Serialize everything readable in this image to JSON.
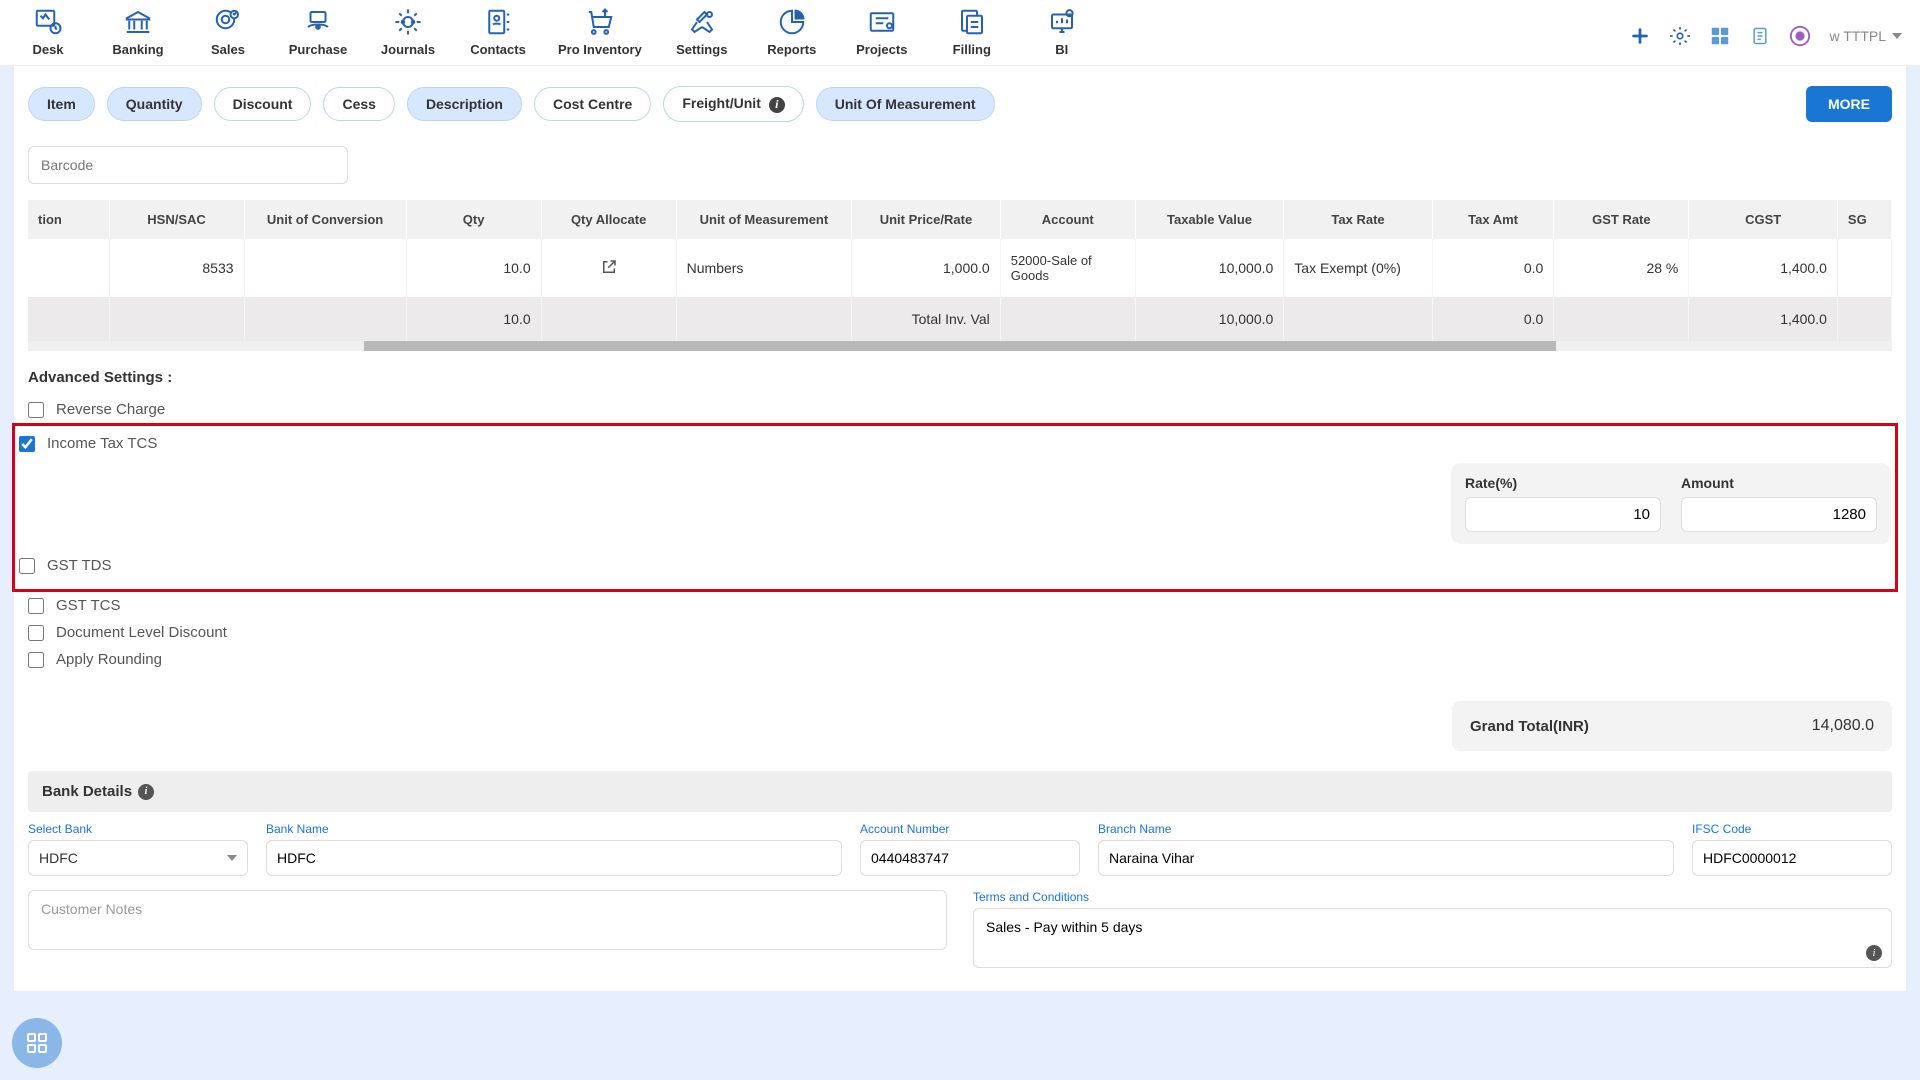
{
  "nav": [
    "Desk",
    "Banking",
    "Sales",
    "Purchase",
    "Journals",
    "Contacts",
    "Pro Inventory",
    "Settings",
    "Reports",
    "Projects",
    "Filling",
    "BI"
  ],
  "account_label": "w TTTPL",
  "chips": [
    {
      "label": "Item",
      "active": true
    },
    {
      "label": "Quantity",
      "active": true
    },
    {
      "label": "Discount",
      "active": false
    },
    {
      "label": "Cess",
      "active": false
    },
    {
      "label": "Description",
      "active": true
    },
    {
      "label": "Cost Centre",
      "active": false
    },
    {
      "label": "Freight/Unit",
      "active": false,
      "info": true
    },
    {
      "label": "Unit Of Measurement",
      "active": true
    }
  ],
  "more_label": "MORE",
  "barcode_placeholder": "Barcode",
  "columns": [
    "tion",
    "HSN/SAC",
    "Unit of Conversion",
    "Qty",
    "Qty Allocate",
    "Unit of Measurement",
    "Unit Price/Rate",
    "Account",
    "Taxable Value",
    "Tax Rate",
    "Tax Amt",
    "GST Rate",
    "CGST",
    "SG"
  ],
  "row": {
    "hsn": "8533",
    "qty": "10.0",
    "uom": "Numbers",
    "rate": "1,000.0",
    "account": "52000-Sale of Goods",
    "taxable": "10,000.0",
    "taxrate": "Tax Exempt (0%)",
    "taxamt": "0.0",
    "gstrate": "28 %",
    "cgst": "1,400.0"
  },
  "totals": {
    "qty": "10.0",
    "inv_lbl": "Total Inv. Val",
    "inv_val": "10,000.0",
    "taxamt": "0.0",
    "cgst": "1,400.0"
  },
  "adv_title": "Advanced Settings :",
  "checks": {
    "reverse": "Reverse Charge",
    "tcs": "Income Tax TCS",
    "gst_tds": "GST TDS",
    "gst_tcs": "GST TCS",
    "doc_disc": "Document Level Discount",
    "rounding": "Apply Rounding"
  },
  "tcs_panel": {
    "rate_label": "Rate(%)",
    "rate": "10",
    "amount_label": "Amount",
    "amount": "1280"
  },
  "grand_total": {
    "label": "Grand Total(INR)",
    "value": "14,080.0"
  },
  "bank_header": "Bank Details",
  "bank": {
    "select_label": "Select Bank",
    "select_value": "HDFC",
    "name_label": "Bank Name",
    "name_value": "HDFC",
    "acc_label": "Account Number",
    "acc_value": "0440483747",
    "branch_label": "Branch Name",
    "branch_value": "Naraina Vihar",
    "ifsc_label": "IFSC Code",
    "ifsc_value": "HDFC0000012"
  },
  "notes_placeholder": "Customer Notes",
  "terms_label": "Terms and Conditions",
  "terms_value": "Sales - Pay within 5 days"
}
